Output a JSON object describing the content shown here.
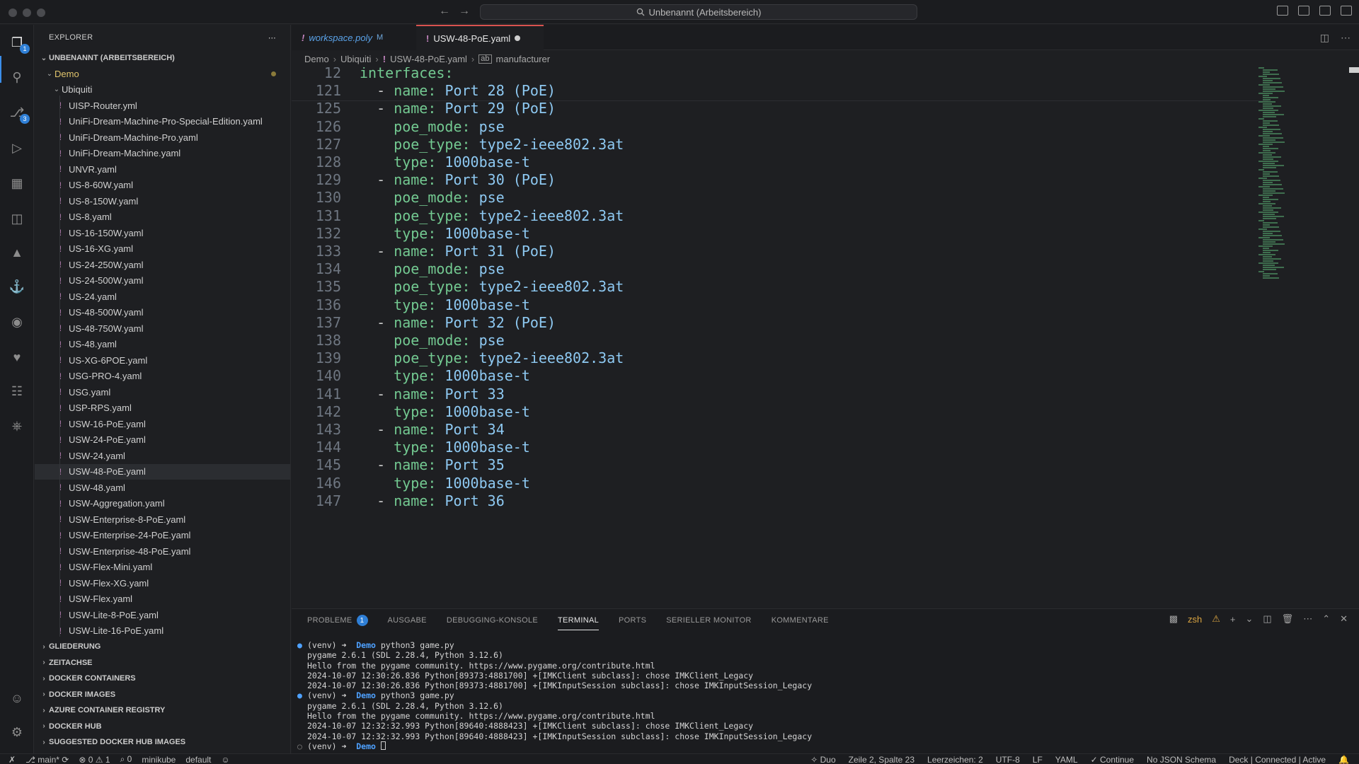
{
  "window": {
    "title": "Unbenannt (Arbeitsbereich)"
  },
  "sidebar": {
    "header": "EXPLORER",
    "workspace": "UNBENANNT (ARBEITSBEREICH)",
    "folder_demo": "Demo",
    "folder_ubiquiti": "Ubiquiti",
    "files": [
      "UISP-Router.yml",
      "UniFi-Dream-Machine-Pro-Special-Edition.yaml",
      "UniFi-Dream-Machine-Pro.yaml",
      "UniFi-Dream-Machine.yaml",
      "UNVR.yaml",
      "US-8-60W.yaml",
      "US-8-150W.yaml",
      "US-8.yaml",
      "US-16-150W.yaml",
      "US-16-XG.yaml",
      "US-24-250W.yaml",
      "US-24-500W.yaml",
      "US-24.yaml",
      "US-48-500W.yaml",
      "US-48-750W.yaml",
      "US-48.yaml",
      "US-XG-6POE.yaml",
      "USG-PRO-4.yaml",
      "USG.yaml",
      "USP-RPS.yaml",
      "USW-16-PoE.yaml",
      "USW-24-PoE.yaml",
      "USW-24.yaml",
      "USW-48-PoE.yaml",
      "USW-48.yaml",
      "USW-Aggregation.yaml",
      "USW-Enterprise-8-PoE.yaml",
      "USW-Enterprise-24-PoE.yaml",
      "USW-Enterprise-48-PoE.yaml",
      "USW-Flex-Mini.yaml",
      "USW-Flex-XG.yaml",
      "USW-Flex.yaml",
      "USW-Lite-8-PoE.yaml",
      "USW-Lite-16-PoE.yaml"
    ],
    "sections": [
      "GLIEDERUNG",
      "ZEITACHSE",
      "DOCKER CONTAINERS",
      "DOCKER IMAGES",
      "AZURE CONTAINER REGISTRY",
      "DOCKER HUB",
      "SUGGESTED DOCKER HUB IMAGES"
    ]
  },
  "tabs": {
    "inactive": {
      "label": "workspace.poly",
      "badge": "M"
    },
    "active": {
      "label": "USW-48-PoE.yaml"
    }
  },
  "breadcrumb": {
    "parts": [
      "Demo",
      "Ubiquiti",
      "USW-48-PoE.yaml",
      "manufacturer"
    ]
  },
  "editor": {
    "lines": [
      {
        "n": "12",
        "indent": "",
        "dash": "",
        "key": "interfaces:",
        "val": ""
      },
      {
        "n": "121",
        "indent": "  ",
        "dash": "- ",
        "key": "name:",
        "val": " Port 28 (PoE)"
      },
      {
        "n": "125",
        "indent": "  ",
        "dash": "- ",
        "key": "name:",
        "val": " Port 29 (PoE)"
      },
      {
        "n": "126",
        "indent": "    ",
        "dash": "",
        "key": "poe_mode:",
        "val": " pse"
      },
      {
        "n": "127",
        "indent": "    ",
        "dash": "",
        "key": "poe_type:",
        "val": " type2-ieee802.3at"
      },
      {
        "n": "128",
        "indent": "    ",
        "dash": "",
        "key": "type:",
        "val": " 1000base-t"
      },
      {
        "n": "129",
        "indent": "  ",
        "dash": "- ",
        "key": "name:",
        "val": " Port 30 (PoE)"
      },
      {
        "n": "130",
        "indent": "    ",
        "dash": "",
        "key": "poe_mode:",
        "val": " pse"
      },
      {
        "n": "131",
        "indent": "    ",
        "dash": "",
        "key": "poe_type:",
        "val": " type2-ieee802.3at"
      },
      {
        "n": "132",
        "indent": "    ",
        "dash": "",
        "key": "type:",
        "val": " 1000base-t"
      },
      {
        "n": "133",
        "indent": "  ",
        "dash": "- ",
        "key": "name:",
        "val": " Port 31 (PoE)"
      },
      {
        "n": "134",
        "indent": "    ",
        "dash": "",
        "key": "poe_mode:",
        "val": " pse"
      },
      {
        "n": "135",
        "indent": "    ",
        "dash": "",
        "key": "poe_type:",
        "val": " type2-ieee802.3at"
      },
      {
        "n": "136",
        "indent": "    ",
        "dash": "",
        "key": "type:",
        "val": " 1000base-t"
      },
      {
        "n": "137",
        "indent": "  ",
        "dash": "- ",
        "key": "name:",
        "val": " Port 32 (PoE)"
      },
      {
        "n": "138",
        "indent": "    ",
        "dash": "",
        "key": "poe_mode:",
        "val": " pse"
      },
      {
        "n": "139",
        "indent": "    ",
        "dash": "",
        "key": "poe_type:",
        "val": " type2-ieee802.3at"
      },
      {
        "n": "140",
        "indent": "    ",
        "dash": "",
        "key": "type:",
        "val": " 1000base-t"
      },
      {
        "n": "141",
        "indent": "  ",
        "dash": "- ",
        "key": "name:",
        "val": " Port 33"
      },
      {
        "n": "142",
        "indent": "    ",
        "dash": "",
        "key": "type:",
        "val": " 1000base-t"
      },
      {
        "n": "143",
        "indent": "  ",
        "dash": "- ",
        "key": "name:",
        "val": " Port 34"
      },
      {
        "n": "144",
        "indent": "    ",
        "dash": "",
        "key": "type:",
        "val": " 1000base-t"
      },
      {
        "n": "145",
        "indent": "  ",
        "dash": "- ",
        "key": "name:",
        "val": " Port 35"
      },
      {
        "n": "146",
        "indent": "    ",
        "dash": "",
        "key": "type:",
        "val": " 1000base-t"
      },
      {
        "n": "147",
        "indent": "  ",
        "dash": "- ",
        "key": "name:",
        "val": " Port 36"
      }
    ]
  },
  "panel": {
    "tabs": [
      "PROBLEME",
      "AUSGABE",
      "DEBUGGING-KONSOLE",
      "TERMINAL",
      "PORTS",
      "SERIELLER MONITOR",
      "KOMMENTARE"
    ],
    "problems_count": "1",
    "active_tab": "TERMINAL",
    "shell": "zsh",
    "terminal": [
      {
        "type": "prompt",
        "env": "(venv)",
        "dir": "Demo",
        "cmd": " python3 game.py"
      },
      {
        "type": "out",
        "text": "pygame 2.6.1 (SDL 2.28.4, Python 3.12.6)"
      },
      {
        "type": "out",
        "text": "Hello from the pygame community. https://www.pygame.org/contribute.html"
      },
      {
        "type": "out",
        "text": "2024-10-07 12:30:26.836 Python[89373:4881700] +[IMKClient subclass]: chose IMKClient_Legacy"
      },
      {
        "type": "out",
        "text": "2024-10-07 12:30:26.836 Python[89373:4881700] +[IMKInputSession subclass]: chose IMKInputSession_Legacy"
      },
      {
        "type": "prompt",
        "env": "(venv)",
        "dir": "Demo",
        "cmd": " python3 game.py"
      },
      {
        "type": "out",
        "text": "pygame 2.6.1 (SDL 2.28.4, Python 3.12.6)"
      },
      {
        "type": "out",
        "text": "Hello from the pygame community. https://www.pygame.org/contribute.html"
      },
      {
        "type": "out",
        "text": "2024-10-07 12:32:32.993 Python[89640:4888423] +[IMKClient subclass]: chose IMKClient_Legacy"
      },
      {
        "type": "out",
        "text": "2024-10-07 12:32:32.993 Python[89640:4888423] +[IMKInputSession subclass]: chose IMKInputSession_Legacy"
      },
      {
        "type": "current",
        "env": "(venv)",
        "dir": "Demo",
        "cmd": " "
      }
    ]
  },
  "statusbar": {
    "branch": "main*",
    "errors": "0",
    "warnings": "1",
    "ports": "0",
    "cluster": "minikube",
    "namespace": "default",
    "duo": "Duo",
    "position": "Zeile 2, Spalte 23",
    "indent": "Leerzeichen: 2",
    "encoding": "UTF-8",
    "eol": "LF",
    "language": "YAML",
    "continue": "Continue",
    "schema": "No JSON Schema",
    "deck": "Deck | Connected | Active"
  },
  "colors": {
    "yaml_key": "#73c991",
    "yaml_value": "#8ec9f2",
    "accent": "#2f7fd6",
    "active_tab_border": "#d9534f"
  }
}
